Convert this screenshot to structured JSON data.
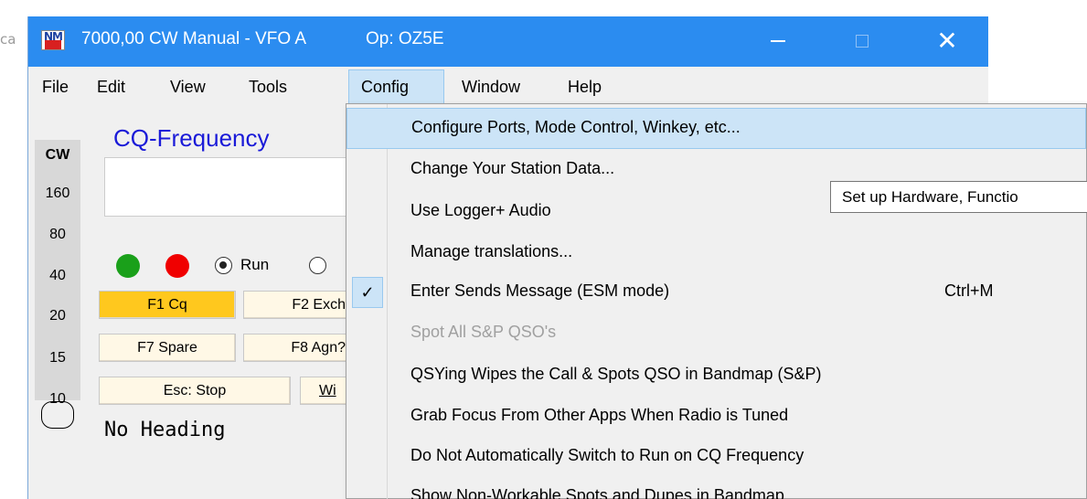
{
  "background": {
    "left_fragment": "ca"
  },
  "window": {
    "title": "7000,00 CW Manual - VFO A",
    "operator": "Op: OZ5E"
  },
  "menubar": {
    "items": [
      {
        "key": "file",
        "label": "File"
      },
      {
        "key": "edit",
        "label": "Edit"
      },
      {
        "key": "view",
        "label": "View"
      },
      {
        "key": "tools",
        "label": "Tools"
      },
      {
        "key": "config",
        "label": "Config"
      },
      {
        "key": "window",
        "label": "Window"
      },
      {
        "key": "help",
        "label": "Help"
      }
    ]
  },
  "bands": {
    "mode": "CW",
    "list": [
      "160",
      "80",
      "40",
      "20",
      "15",
      "10"
    ],
    "selected": "40"
  },
  "cq": {
    "label": "CQ-Frequency",
    "value": ""
  },
  "status": {
    "green_led": "#1aa01a",
    "red_led": "#f00000"
  },
  "run_mode": {
    "run_label": "Run",
    "selected": "Run"
  },
  "function_keys": {
    "f1": "F1 Cq",
    "f2": "F2 Exch",
    "f7": "F7 Spare",
    "f8": "F8 Agn?",
    "esc": "Esc: Stop",
    "wipe": "Wi"
  },
  "heading_text": "No Heading",
  "config_menu": {
    "items": [
      {
        "label": "Configure Ports, Mode Control, Winkey, etc...",
        "highlighted": true,
        "enabled": true
      },
      {
        "label": "Change Your Station Data...",
        "enabled": true
      },
      {
        "label": "Use Logger+ Audio",
        "enabled": true
      },
      {
        "label": "Manage translations...",
        "enabled": true
      },
      {
        "label": "Enter Sends Message (ESM mode)",
        "checked": true,
        "shortcut": "Ctrl+M",
        "enabled": true
      },
      {
        "label": "Spot All S&P QSO's",
        "enabled": false
      },
      {
        "label": "QSYing Wipes the Call & Spots QSO in Bandmap (S&P)",
        "enabled": true
      },
      {
        "label": "Grab Focus From Other Apps When Radio is Tuned",
        "enabled": true
      },
      {
        "label": "Do Not Automatically Switch to Run on CQ Frequency",
        "enabled": true
      },
      {
        "label": "Show Non-Workable Spots and Dupes in Bandmap",
        "enabled": true
      }
    ],
    "check_glyph": "✓"
  },
  "tooltip": {
    "text": "Set up Hardware, Functio"
  },
  "colors": {
    "titlebar": "#2b8cf0",
    "menu_highlight": "#cce4f7",
    "active_fkey": "#ffc81e",
    "cq_label": "#1a1ad8"
  }
}
